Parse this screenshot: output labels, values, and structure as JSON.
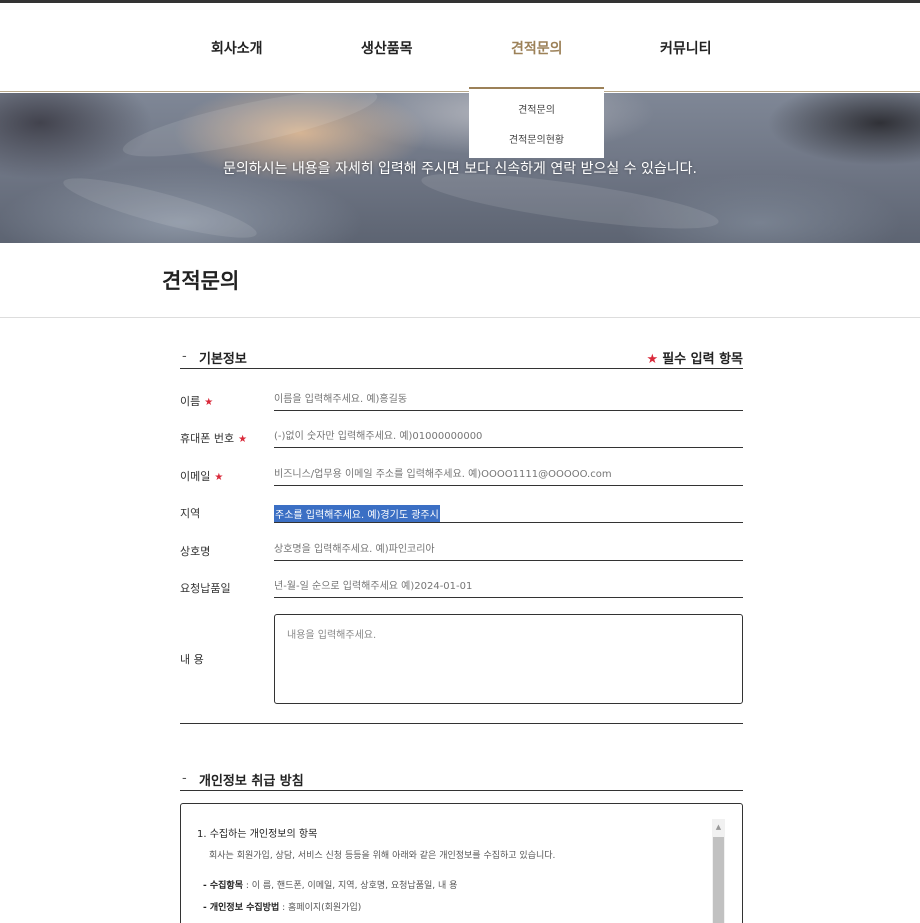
{
  "nav": {
    "items": [
      {
        "label": "회사소개"
      },
      {
        "label": "생산품목"
      },
      {
        "label": "견적문의"
      },
      {
        "label": "커뮤니티"
      }
    ],
    "dropdown": [
      "견적문의",
      "견적문의현황"
    ]
  },
  "hero": {
    "text": "문의하시는 내용을 자세히 입력해 주시면 보다 신속하게 연락 받으실 수 있습니다."
  },
  "page": {
    "title": "견적문의"
  },
  "form": {
    "section_title": "기본정보",
    "dash": "-",
    "required_note": "필수 입력 항목",
    "required_star": "★",
    "fields": [
      {
        "label": "이름",
        "required": true,
        "placeholder": "이름을 입력해주세요. 예)홍길동"
      },
      {
        "label": "휴대폰 번호",
        "required": true,
        "placeholder": "(-)없이 숫자만 입력해주세요. 예)01000000000"
      },
      {
        "label": "이메일",
        "required": true,
        "placeholder": "비즈니스/업무용 이메일 주소를 입력해주세요. 예)OOOO1111@OOOOO.com"
      },
      {
        "label": "지역",
        "required": false,
        "value": "주소를 입력해주세요. 예)경기도 광주시"
      },
      {
        "label": "상호명",
        "required": false,
        "placeholder": "상호명을 입력해주세요. 예)파인코리아"
      },
      {
        "label": "요청납품일",
        "required": false,
        "placeholder": "년-월-일 순으로 입력해주세요 예)2024-01-01"
      }
    ],
    "content": {
      "label": "내 용",
      "placeholder": "내용을 입력해주세요."
    }
  },
  "privacy": {
    "section_title": "개인정보 취급 방침",
    "dash": "-",
    "heading": "1. 수집하는 개인정보의 항목",
    "description": "회사는 회원가입, 상담, 서비스 신청 등등을 위해 아래와 같은 개인정보를 수집하고 있습니다.",
    "items": [
      {
        "key": "- 수집항목",
        "value": " : 이 름, 핸드폰, 이메일, 지역, 상호명, 요청납품일, 내 용"
      },
      {
        "key": "- 개인정보 수집방법",
        "value": " : 홈페이지(회원가입)"
      }
    ],
    "scroll_up_glyph": "▲"
  }
}
